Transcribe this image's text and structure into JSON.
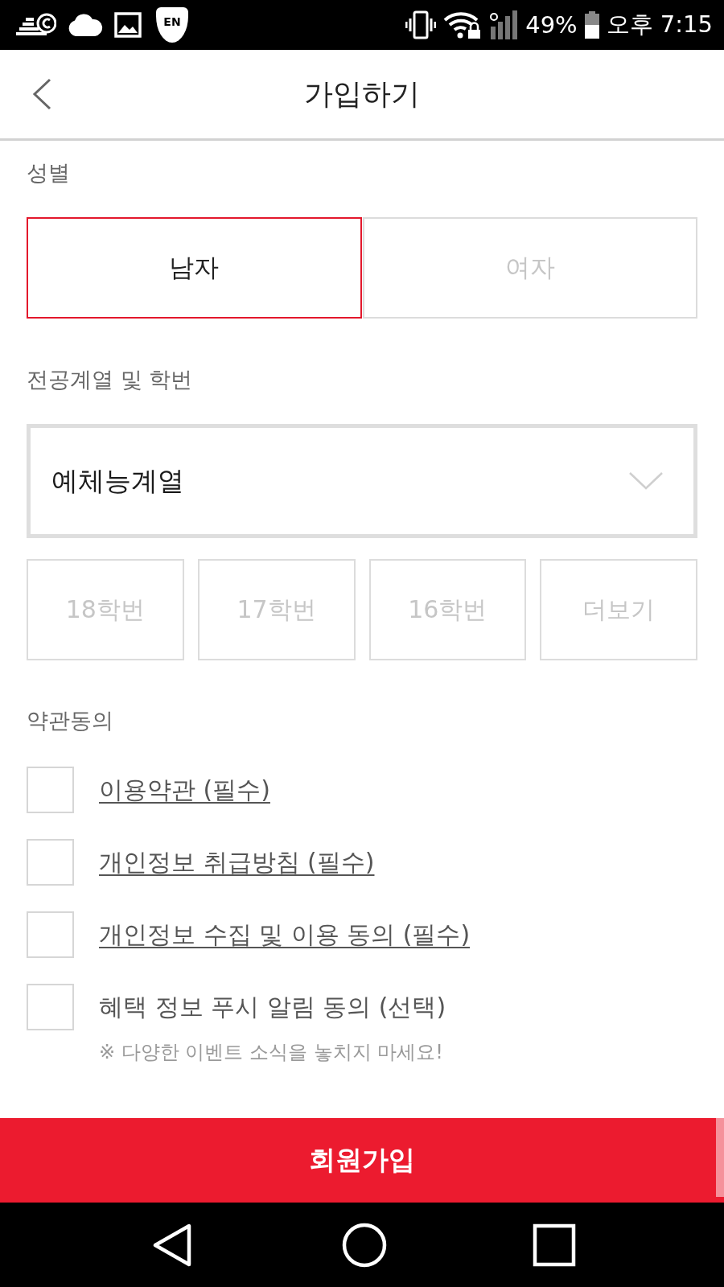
{
  "status_bar": {
    "badge": "EN",
    "battery": "49%",
    "time": "오후 7:15"
  },
  "header": {
    "title": "가입하기"
  },
  "gender": {
    "label": "성별",
    "options": [
      {
        "label": "남자",
        "selected": true
      },
      {
        "label": "여자",
        "selected": false
      }
    ]
  },
  "major": {
    "label": "전공계열 및 학번",
    "select": {
      "value": "예체능계열"
    },
    "years": [
      {
        "label": "18학번",
        "selected": false
      },
      {
        "label": "17학번",
        "selected": false
      },
      {
        "label": "16학번",
        "selected": false
      },
      {
        "label": "더보기",
        "selected": false
      }
    ]
  },
  "terms": {
    "label": "약관동의",
    "items": [
      {
        "kind": "link",
        "text": "이용약관 (필수)",
        "checked": false
      },
      {
        "kind": "link",
        "text": "개인정보 취급방침 (필수)",
        "checked": false
      },
      {
        "kind": "link",
        "text": "개인정보 수집 및 이용 동의 (필수)",
        "checked": false
      },
      {
        "kind": "plain",
        "text": "혜택 정보 푸시 알림 동의 (선택)",
        "checked": false,
        "note": "※ 다양한 이벤트 소식을 놓치지 마세요!"
      }
    ]
  },
  "submit": {
    "label": "회원가입"
  }
}
